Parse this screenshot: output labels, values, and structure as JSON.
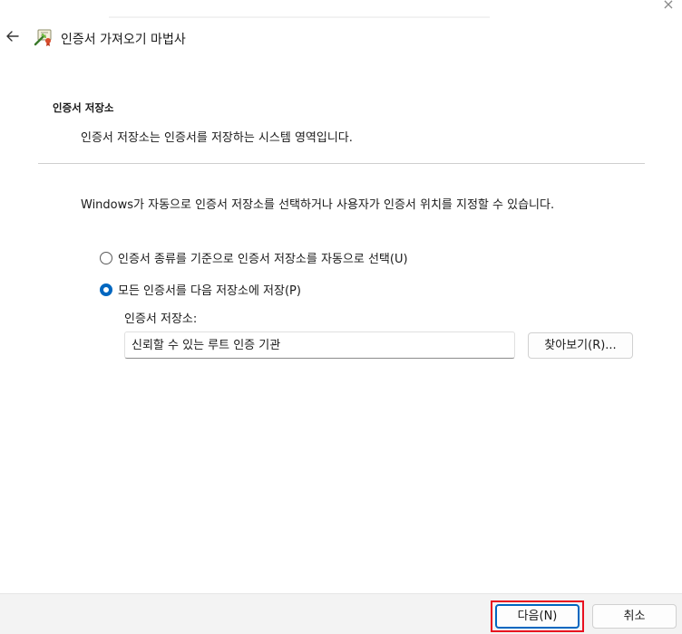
{
  "window": {
    "title": "인증서 가져오기 마법사",
    "close_glyph": "×",
    "back_glyph": "←"
  },
  "header": {
    "section_title": "인증서 저장소",
    "section_description": "인증서 저장소는 인증서를 저장하는 시스템 영역입니다."
  },
  "body": {
    "info_text": "Windows가 자동으로 인증서 저장소를 선택하거나 사용자가 인증서 위치를 지정할 수 있습니다.",
    "options": [
      {
        "label": "인증서 종류를 기준으로 인증서 저장소를 자동으로 선택(U)",
        "selected": false
      },
      {
        "label": "모든 인증서를 다음 저장소에 저장(P)",
        "selected": true
      }
    ],
    "store_label": "인증서 저장소:",
    "store_value": "신뢰할 수 있는 루트 인증 기관",
    "browse_button": "찾아보기(R)..."
  },
  "footer": {
    "next_button": "다음(N)",
    "cancel_button": "취소"
  },
  "colors": {
    "accent": "#0067c0",
    "highlight": "#e8101f",
    "footer_bg": "#f3f3f3"
  }
}
